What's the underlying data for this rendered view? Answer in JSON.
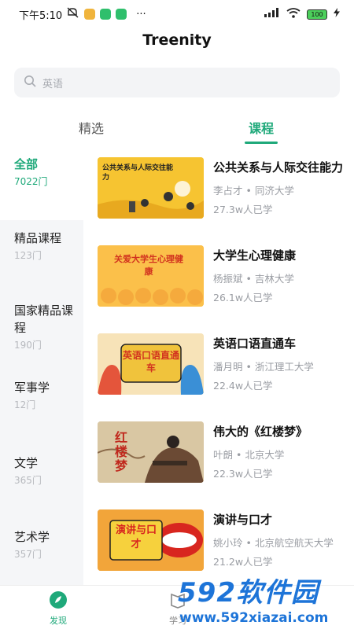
{
  "status_bar": {
    "time": "下午5:10",
    "more": "···",
    "battery": "100"
  },
  "app": {
    "title": "Treenity"
  },
  "search": {
    "placeholder": "英语"
  },
  "tabs": [
    {
      "label": "精选",
      "active": false
    },
    {
      "label": "课程",
      "active": true
    }
  ],
  "categories": [
    {
      "name": "全部",
      "count": "7022门",
      "active": true
    },
    {
      "name": "精品课程",
      "count": "123门",
      "active": false
    },
    {
      "name": "国家精品课程",
      "count": "190门",
      "active": false
    },
    {
      "name": "军事学",
      "count": "12门",
      "active": false
    },
    {
      "name": "文学",
      "count": "365门",
      "active": false
    },
    {
      "name": "艺术学",
      "count": "357门",
      "active": false
    }
  ],
  "courses": [
    {
      "title": "公共关系与人际交往能力",
      "teacher": "李占才 • 同济大学",
      "learners": "27.3w人已学",
      "thumb_text": "公共关系与人际交往能力"
    },
    {
      "title": "大学生心理健康",
      "teacher": "杨振斌 • 吉林大学",
      "learners": "26.1w人已学",
      "thumb_text": "关爱大学生心理健康"
    },
    {
      "title": "英语口语直通车",
      "teacher": "潘月明 • 浙江理工大学",
      "learners": "22.4w人已学",
      "thumb_text": "英语口语直通车"
    },
    {
      "title": "伟大的《红楼梦》",
      "teacher": "叶朗 • 北京大学",
      "learners": "22.3w人已学",
      "thumb_text": "红楼梦"
    },
    {
      "title": "演讲与口才",
      "teacher": "姚小玲 • 北京航空航天大学",
      "learners": "21.2w人已学",
      "thumb_text": "演讲与口才"
    }
  ],
  "bottom_nav": [
    {
      "label": "发现",
      "active": true
    },
    {
      "label": "学习",
      "active": false
    }
  ],
  "watermark": {
    "brand": "592软件园",
    "url": "www.592xiazai.com"
  },
  "colors": {
    "accent": "#1fa97a",
    "watermark": "#1d74d8"
  }
}
